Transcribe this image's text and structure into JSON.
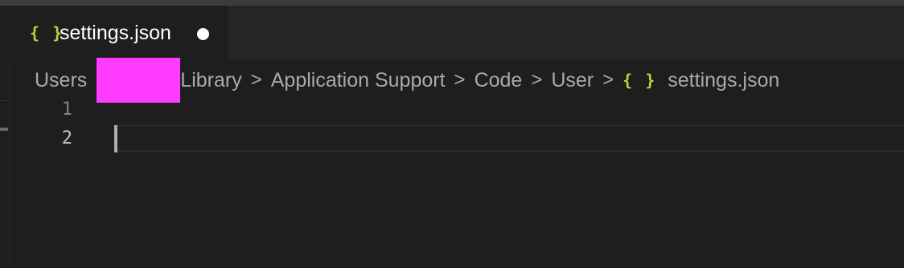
{
  "tab": {
    "icon": "{ }",
    "label": "settings.json",
    "dirty": true
  },
  "breadcrumb": {
    "items": [
      "Users",
      "Library",
      "Application Support",
      "Code",
      "User"
    ],
    "file_icon": "{ }",
    "file": "settings.json",
    "separator": ">"
  },
  "editor": {
    "line_numbers": [
      "1",
      "2"
    ],
    "current_line": 2
  },
  "colors": {
    "background": "#1e1e1e",
    "json_icon": "#cbcb41",
    "redaction": "#ff3bff"
  }
}
